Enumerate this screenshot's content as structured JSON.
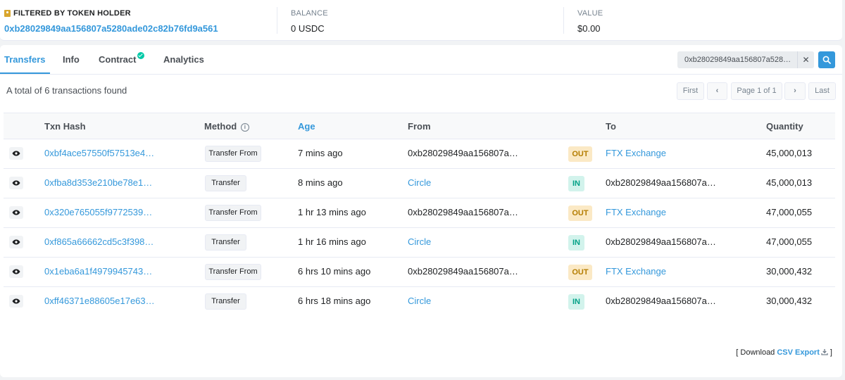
{
  "holder": {
    "label": "FILTERED BY TOKEN HOLDER",
    "address": "0xb28029849aa156807a5280ade02c82b76fd9a561",
    "balance_label": "BALANCE",
    "balance_value": "0 USDC",
    "value_label": "VALUE",
    "value_value": "$0.00"
  },
  "tabs": [
    {
      "label": "Transfers",
      "active": true
    },
    {
      "label": "Info"
    },
    {
      "label": "Contract",
      "verified": true
    },
    {
      "label": "Analytics"
    }
  ],
  "search": {
    "value": "0xb28029849aa156807a528…",
    "clear_glyph": "✕"
  },
  "summary": "A total of 6 transactions found",
  "pager": {
    "first": "First",
    "prev": "‹",
    "info": "Page 1 of 1",
    "next": "›",
    "last": "Last"
  },
  "table": {
    "headers": {
      "txn_hash": "Txn Hash",
      "method": "Method",
      "age": "Age",
      "from": "From",
      "to": "To",
      "quantity": "Quantity"
    },
    "rows": [
      {
        "hash": "0xbf4ace57550f57513e4…",
        "method": "Transfer From",
        "age": "7 mins ago",
        "from": "0xb28029849aa156807a…",
        "from_link": false,
        "dir": "OUT",
        "to": "FTX Exchange",
        "to_link": true,
        "qty": "45,000,013"
      },
      {
        "hash": "0xfba8d353e210be78e1…",
        "method": "Transfer",
        "age": "8 mins ago",
        "from": "Circle",
        "from_link": true,
        "dir": "IN",
        "to": "0xb28029849aa156807a…",
        "to_link": false,
        "qty": "45,000,013"
      },
      {
        "hash": "0x320e765055f9772539…",
        "method": "Transfer From",
        "age": "1 hr 13 mins ago",
        "from": "0xb28029849aa156807a…",
        "from_link": false,
        "dir": "OUT",
        "to": "FTX Exchange",
        "to_link": true,
        "qty": "47,000,055"
      },
      {
        "hash": "0xf865a66662cd5c3f398…",
        "method": "Transfer",
        "age": "1 hr 16 mins ago",
        "from": "Circle",
        "from_link": true,
        "dir": "IN",
        "to": "0xb28029849aa156807a…",
        "to_link": false,
        "qty": "47,000,055"
      },
      {
        "hash": "0x1eba6a1f4979945743…",
        "method": "Transfer From",
        "age": "6 hrs 10 mins ago",
        "from": "0xb28029849aa156807a…",
        "from_link": false,
        "dir": "OUT",
        "to": "FTX Exchange",
        "to_link": true,
        "qty": "30,000,432"
      },
      {
        "hash": "0xff46371e88605e17e63…",
        "method": "Transfer",
        "age": "6 hrs 18 mins ago",
        "from": "Circle",
        "from_link": true,
        "dir": "IN",
        "to": "0xb28029849aa156807a…",
        "to_link": false,
        "qty": "30,000,432"
      }
    ]
  },
  "csv": {
    "prefix": "[ Download ",
    "link": "CSV Export",
    "suffix": " ]"
  },
  "colors": {
    "accent": "#3498db",
    "out_badge_bg": "#fbe9c5",
    "out_badge_text": "#b47d00",
    "in_badge_bg": "#d2f3ec",
    "in_badge_text": "#00a186",
    "verified": "#00c9a7"
  },
  "icons": [
    "tag-icon",
    "verified-check-icon",
    "close-icon",
    "search-icon",
    "info-icon",
    "eye-icon",
    "download-icon"
  ]
}
